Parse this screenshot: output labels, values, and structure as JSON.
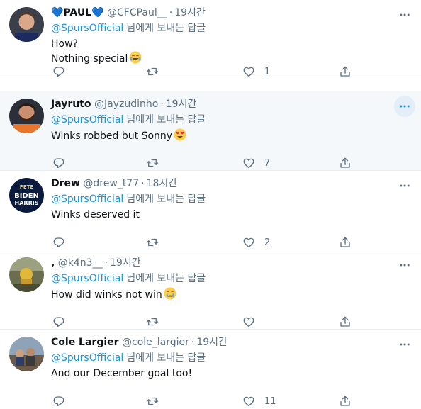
{
  "common": {
    "reply_prefix": "@SpursOfficial",
    "reply_suffix": "님에게 보내는 답글",
    "separator": "·"
  },
  "icons": [
    "more-icon",
    "reply-icon",
    "retweet-icon",
    "like-icon",
    "share-icon"
  ],
  "colors": {
    "link": "#1b95e0",
    "muted": "#5b7083",
    "hover_bg": "#f5f8fa",
    "more_active_bg": "#e3eef8"
  },
  "tweets": [
    {
      "display_name": "PAUL",
      "handle": "@CFCPaul__",
      "time": "19시간",
      "body_line1": "How?",
      "body_line2": "Nothing special",
      "like_count": "1"
    },
    {
      "display_name": "Jayruto",
      "handle": "@Jayzudinho",
      "time": "19시간",
      "body_line1": "Winks robbed but Sonny",
      "like_count": "7"
    },
    {
      "display_name": "Drew",
      "handle": "@drew_t77",
      "time": "18시간",
      "body_line1": "Winks deserved it",
      "like_count": "2",
      "avatar_text_top": "PETE",
      "avatar_text_mid": "BIDEN",
      "avatar_text_bot": "HARRIS"
    },
    {
      "display_name": ",",
      "handle": "@k4n3__",
      "time": "19시간",
      "body_line1": "How did winks not win"
    },
    {
      "display_name": "Cole Largier",
      "handle": "@cole_largier",
      "time": "19시간",
      "body_line1": "And our December goal too!",
      "like_count": "11"
    }
  ]
}
